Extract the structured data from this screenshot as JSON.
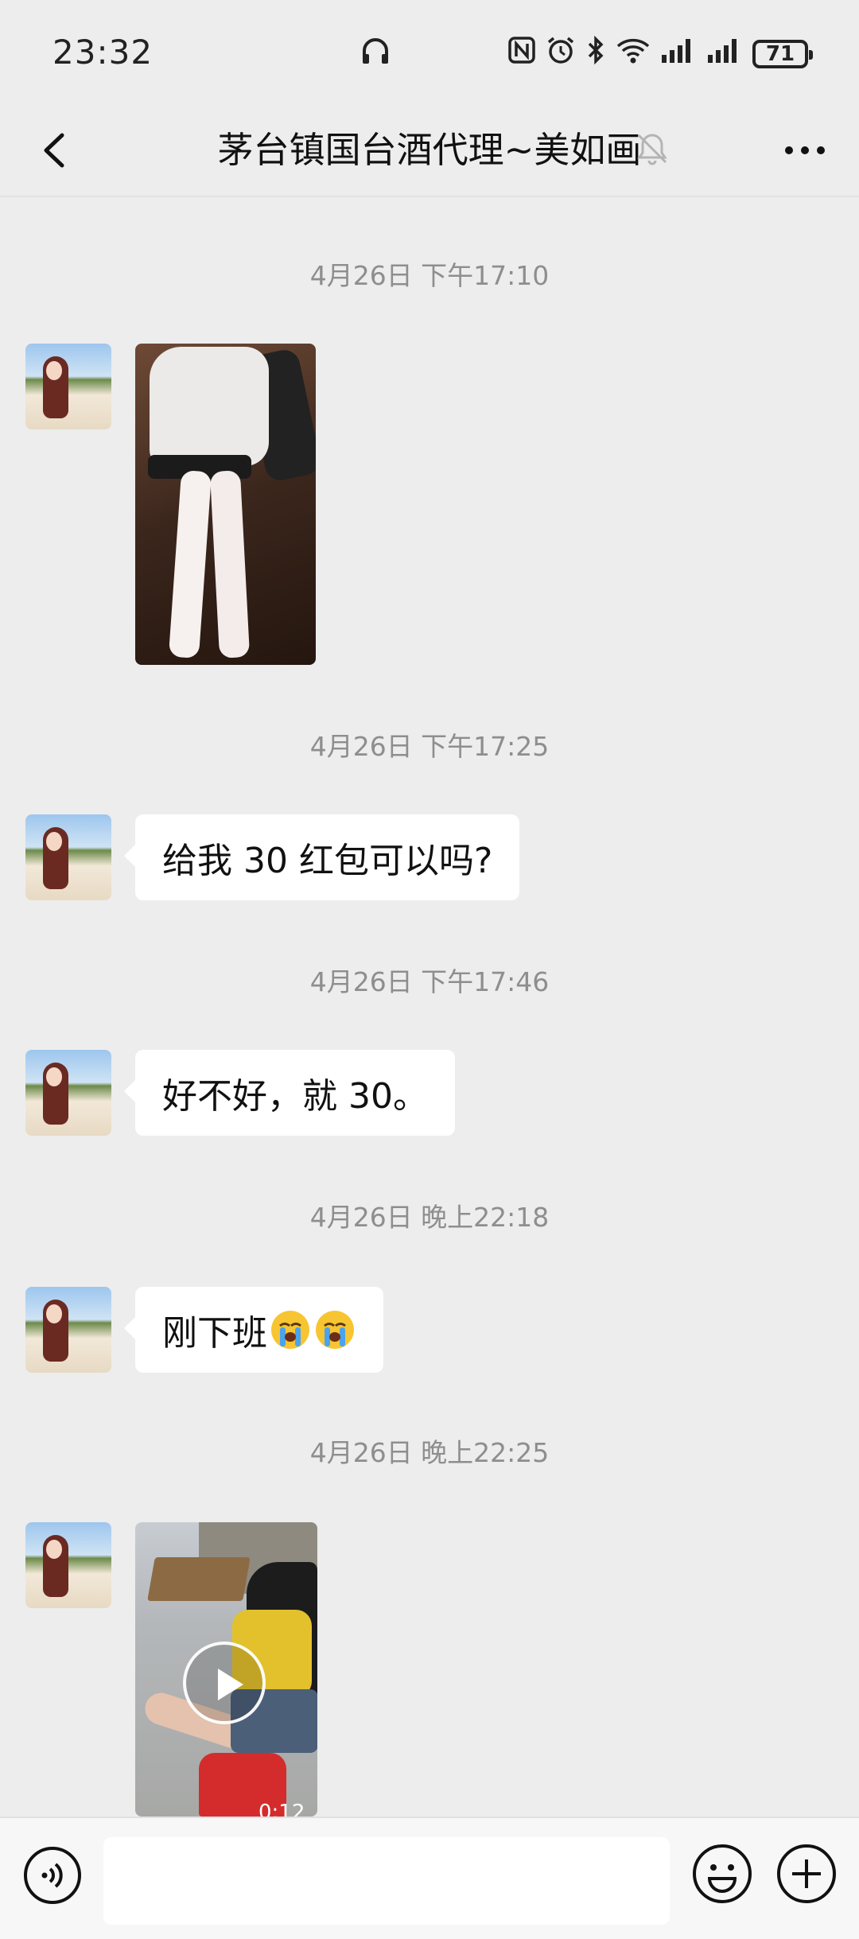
{
  "status_bar": {
    "time": "23:32",
    "battery": "71",
    "icons": [
      "headphones-icon",
      "nfc-icon",
      "alarm-icon",
      "bluetooth-icon",
      "wifi-icon",
      "signal-icon",
      "signal-icon"
    ]
  },
  "header": {
    "title": "茅台镇国台酒代理~美如画",
    "muted_icon": "bell-muted-icon",
    "more_icon": "more-icon"
  },
  "messages": [
    {
      "timestamp": "4月26日 下午17:10",
      "type": "image"
    },
    {
      "timestamp": "4月26日 下午17:25",
      "type": "text",
      "text": "给我 30 红包可以吗?"
    },
    {
      "timestamp": "4月26日 下午17:46",
      "type": "text",
      "text": "好不好，就 30。"
    },
    {
      "timestamp": "4月26日 晚上22:18",
      "type": "text",
      "text": "刚下班",
      "emoji": [
        "crying-face-emoji",
        "crying-face-emoji"
      ]
    },
    {
      "timestamp": "4月26日 晚上22:25",
      "type": "video",
      "duration": "0:12"
    }
  ],
  "input_bar": {
    "placeholder": "",
    "icons": [
      "voice-icon",
      "emoji-icon",
      "plus-icon"
    ]
  }
}
